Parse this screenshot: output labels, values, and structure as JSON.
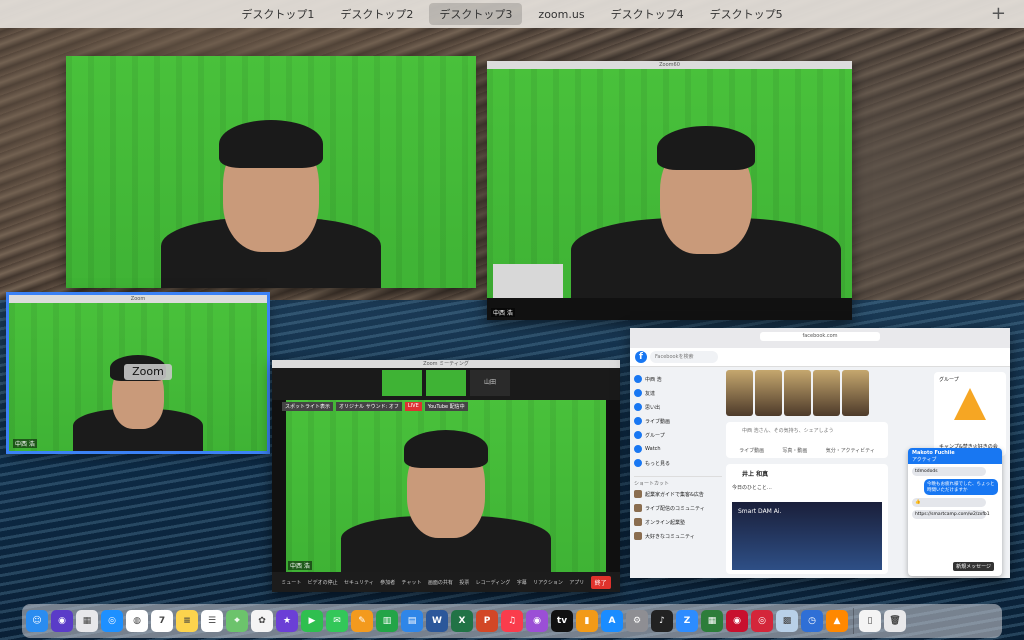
{
  "mission_control": {
    "desktops": [
      "デスクトップ1",
      "デスクトップ2",
      "デスクトップ3",
      "zoom.us",
      "デスクトップ4",
      "デスクトップ5"
    ],
    "active_index": 2,
    "add_label": "+"
  },
  "windows": {
    "top_right_title": "Zoom60",
    "top_right_name": "中西 浩",
    "small_title": "Zoom",
    "small_name": "中西 浩",
    "zoom_label": "Zoom",
    "meeting_title": "Zoom ミーティング",
    "meeting_name": "中西 浩"
  },
  "meeting": {
    "thumb_label": "山田",
    "rec_pills": [
      "スポットライト表示",
      "オリジナル サウンド: オフ",
      "LIVE",
      "YouTube 配信中"
    ],
    "toolbar": [
      "ミュート",
      "ビデオの停止",
      "セキュリティ",
      "参加者",
      "チャット",
      "画面の共有",
      "投票",
      "レコーディング",
      "字幕",
      "リアクション",
      "アプリ"
    ],
    "end_label": "終了"
  },
  "facebook": {
    "url": "facebook.com",
    "logo": "f",
    "search_placeholder": "Facebookを検索",
    "sidebar": [
      "中西 浩",
      "友達",
      "思い出",
      "ライブ動画",
      "グループ",
      "Watch",
      "もっと見る"
    ],
    "shortcuts_title": "ショートカット",
    "shortcuts": [
      "起業家ガイドで集客&広告",
      "ライブ配信のコミュニティ",
      "オンライン起業塾",
      "大好きなコミュニティ"
    ],
    "post_placeholder": "中西 浩さん、その気持ち、シェアしよう",
    "post_actions": [
      "ライブ動画",
      "写真・動画",
      "気分・アクティビティ"
    ],
    "post_author": "井上 和真",
    "post_text": "今日のひとこと…",
    "post_image_text": "Smart DAM Ai.",
    "group_title": "グループ",
    "group_name": "キャンプ&焚き火好きの会"
  },
  "messenger": {
    "contact": "Makoto Fuchiie",
    "status": "アクティブ",
    "messages": [
      {
        "dir": "in",
        "text": "tdmodods"
      },
      {
        "dir": "out",
        "text": "今晩もお疲れ様でした、ちょっと時間いただけますか"
      },
      {
        "dir": "in",
        "text": "👍"
      },
      {
        "dir": "in",
        "text": "https://smartcamp.com/w2/zxfb1"
      }
    ],
    "new_message_label": "新規メッセージ"
  },
  "dock": {
    "apps": [
      {
        "name": "finder-icon",
        "color": "#2a8cf0"
      },
      {
        "name": "siri-icon",
        "color": "#5a3cc8"
      },
      {
        "name": "launchpad-icon",
        "color": "#e7e7ea"
      },
      {
        "name": "safari-icon",
        "color": "#1e90ff"
      },
      {
        "name": "chrome-icon",
        "color": "#ffffff"
      },
      {
        "name": "calendar-icon",
        "color": "#ffffff"
      },
      {
        "name": "notes-icon",
        "color": "#fcd34d"
      },
      {
        "name": "reminders-icon",
        "color": "#ffffff"
      },
      {
        "name": "maps-icon",
        "color": "#6cc36c"
      },
      {
        "name": "photos-icon",
        "color": "#f4f4f4"
      },
      {
        "name": "imovie-icon",
        "color": "#6b3fd6"
      },
      {
        "name": "facetime-icon",
        "color": "#2fbf4f"
      },
      {
        "name": "messages-icon",
        "color": "#33c759"
      },
      {
        "name": "pages-icon",
        "color": "#f39a1e"
      },
      {
        "name": "numbers-icon",
        "color": "#23a447"
      },
      {
        "name": "keynote-icon",
        "color": "#2f86e8"
      },
      {
        "name": "word-icon",
        "color": "#2b579a"
      },
      {
        "name": "excel-icon",
        "color": "#217346"
      },
      {
        "name": "powerpoint-icon",
        "color": "#d24726"
      },
      {
        "name": "music-icon",
        "color": "#fa3c4c"
      },
      {
        "name": "podcasts-icon",
        "color": "#9b4fd6"
      },
      {
        "name": "tv-icon",
        "color": "#111111"
      },
      {
        "name": "books-icon",
        "color": "#f29a18"
      },
      {
        "name": "appstore-icon",
        "color": "#1a8cff"
      },
      {
        "name": "settings-icon",
        "color": "#8e8e93"
      },
      {
        "name": "piano-icon",
        "color": "#222222"
      },
      {
        "name": "zoom-icon",
        "color": "#2d8cff"
      },
      {
        "name": "spreadsheet-icon",
        "color": "#2d7d3a"
      },
      {
        "name": "recorder-icon",
        "color": "#c8102e"
      },
      {
        "name": "podcast-red-icon",
        "color": "#d4263a"
      },
      {
        "name": "preview-icon",
        "color": "#b8d0e8"
      },
      {
        "name": "quicktime-icon",
        "color": "#2f6fd6"
      },
      {
        "name": "vlc-icon",
        "color": "#ff8800"
      },
      {
        "name": "document-icon",
        "color": "#f4f4f4"
      },
      {
        "name": "trash-icon",
        "color": "#e8e8ea"
      }
    ],
    "glyphs": [
      "☺",
      "◉",
      "▦",
      "◎",
      "◍",
      "7",
      "≡",
      "☰",
      "⌖",
      "✿",
      "★",
      "▶",
      "✉",
      "✎",
      "▥",
      "▤",
      "W",
      "X",
      "P",
      "♫",
      "◉",
      "tv",
      "▮",
      "A",
      "⚙",
      "♪",
      "Z",
      "▦",
      "◉",
      "◎",
      "▩",
      "◷",
      "▲",
      "▯",
      "🗑"
    ]
  }
}
